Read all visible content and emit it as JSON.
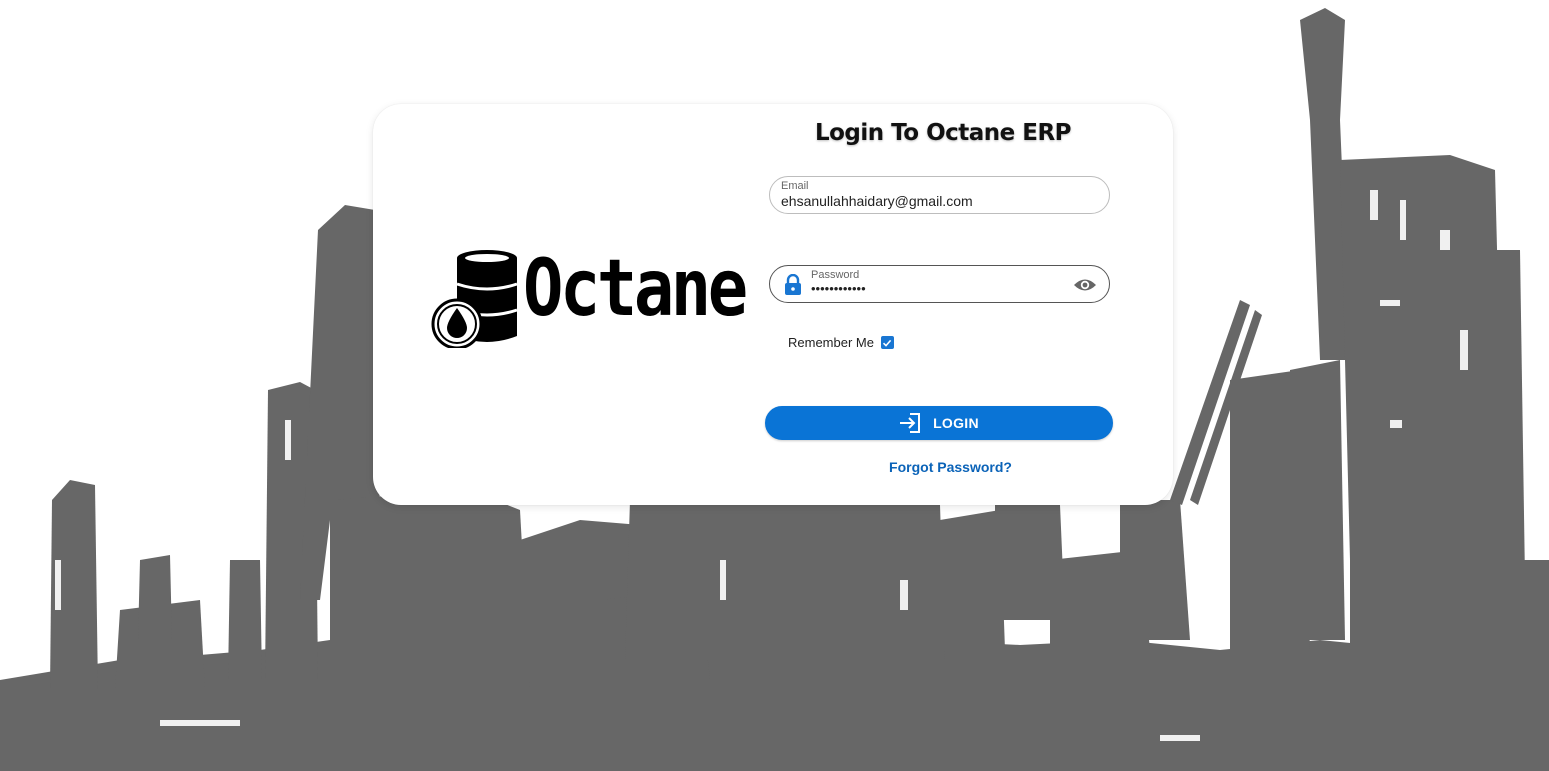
{
  "page": {
    "title": "Login To Octane ERP"
  },
  "brand": {
    "logo_text": "Octane",
    "logo_icon": "oil-barrel-drop-icon"
  },
  "form": {
    "email": {
      "label": "Email",
      "value": "ehsanullahhaidary@gmail.com"
    },
    "password": {
      "label": "Password",
      "value": "••••••••••••",
      "leading_icon": "lock-icon",
      "trailing_icon": "eye-icon"
    },
    "remember_me": {
      "label": "Remember Me",
      "checked": true
    },
    "login_button": {
      "label": "LOGIN",
      "icon": "login-icon"
    },
    "forgot_password": "Forgot Password?"
  },
  "colors": {
    "primary": "#0a74d6",
    "link": "#0b63b8",
    "background_silhouette": "#666666"
  }
}
